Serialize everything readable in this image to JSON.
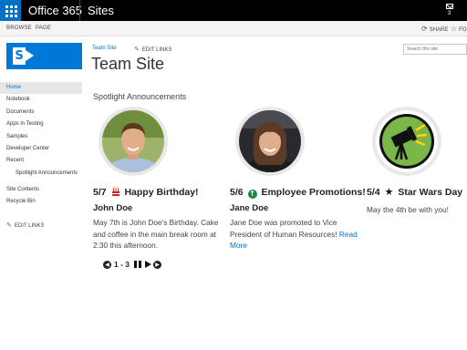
{
  "suite": {
    "brand": "Office 365",
    "app": "Sites",
    "mail_count": "3"
  },
  "ribbon": {
    "browse": "BROWSE",
    "page": "PAGE",
    "share": "SHARE",
    "follow": "FO"
  },
  "header": {
    "breadcrumb": "Team Site",
    "edit_links": "EDIT LINKS",
    "title": "Team Site",
    "search_placeholder": "Search this site"
  },
  "nav": {
    "items": [
      "Home",
      "Notebook",
      "Documents",
      "Apps in Testing",
      "Samples",
      "Developer Center",
      "Recent"
    ],
    "recent_sub": "Spotlight Announcements",
    "site_contents": "Site Contents",
    "recycle_bin": "Recycle Bin",
    "edit_links": "EDIT LINKS"
  },
  "spotlight": {
    "heading": "Spotlight Announcements",
    "cards": [
      {
        "date": "5/7",
        "icon": "birthday-cake-icon",
        "title": "Happy Birthday!",
        "name": "John Doe",
        "body": "May 7th is John Doe's Birthday. Cake and coffee in the main break room at 2:30 this afternoon.",
        "read_more": ""
      },
      {
        "date": "5/6",
        "icon": "up-arrow-circle-icon",
        "title": "Employee Promotions!",
        "name": "Jane Doe",
        "body": "Jane Doe was promoted to Vice President of Human Resources!",
        "read_more": "Read More"
      },
      {
        "date": "5/4",
        "icon": "star-icon",
        "title": "Star Wars Day",
        "name": "",
        "body": "May the 4th be with you!",
        "read_more": ""
      }
    ],
    "pager": {
      "range": "1 - 3"
    }
  },
  "colors": {
    "suite_bar": "#000000",
    "waffle": "#0072c6",
    "link": "#0072c6",
    "logo": "#0078d7",
    "spotlight_icon_bg": "#7ab648"
  }
}
